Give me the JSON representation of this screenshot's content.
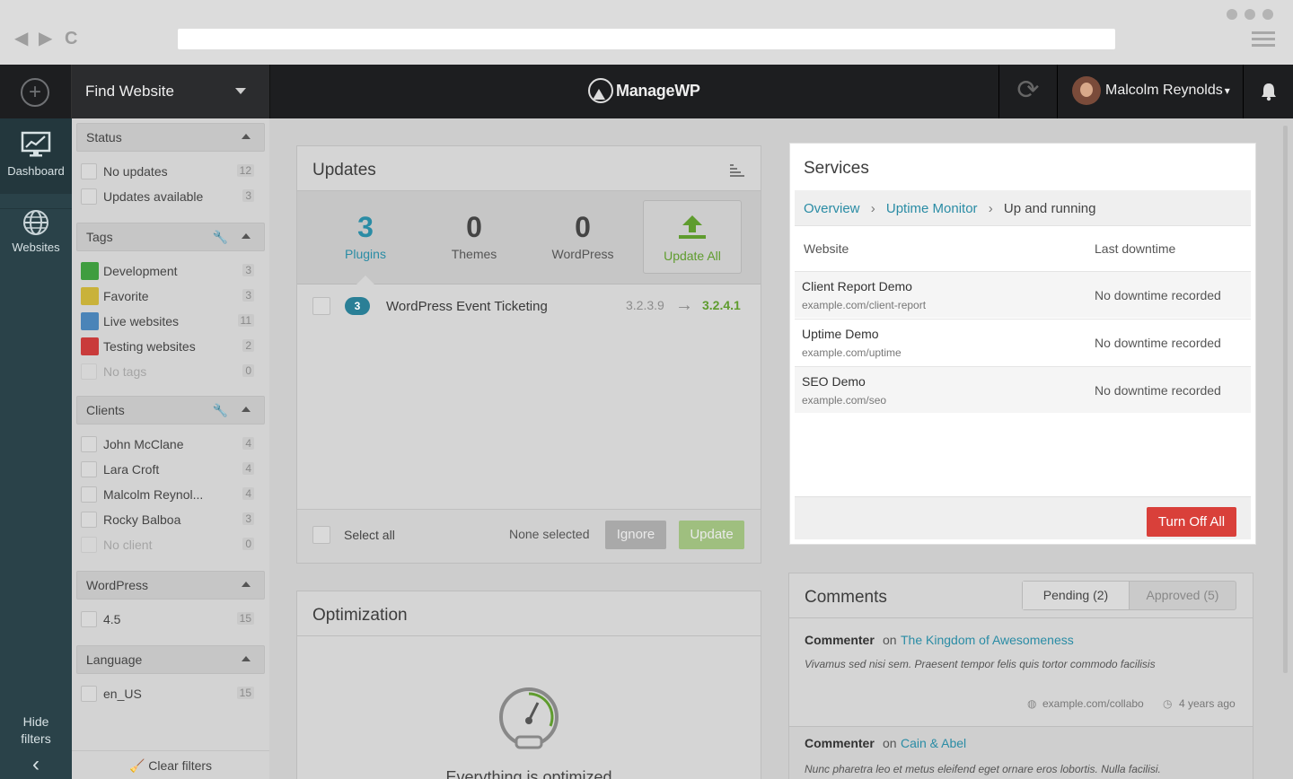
{
  "browser": {
    "nav_back": "◀",
    "nav_forward": "▶",
    "nav_reload": "C"
  },
  "topbar": {
    "add_icon": "+",
    "find_label": "Find Website",
    "logo_text": "ManageWP",
    "refresh_icon": "⟳",
    "user_name": "Malcolm Reynolds",
    "user_caret": "▾"
  },
  "sidebar": {
    "items": [
      {
        "label": "Dashboard",
        "icon": "chart-monitor-icon"
      },
      {
        "label": "Websites",
        "icon": "globe-icon"
      }
    ],
    "hide_filters": "Hide filters",
    "collapse": "‹"
  },
  "filters": {
    "status": {
      "title": "Status",
      "items": [
        {
          "label": "No updates",
          "count": "12"
        },
        {
          "label": "Updates available",
          "count": "3"
        }
      ]
    },
    "tags": {
      "title": "Tags",
      "items": [
        {
          "label": "Development",
          "count": "3",
          "color": "#3f9d3f"
        },
        {
          "label": "Favorite",
          "count": "3",
          "color": "#c9b23a"
        },
        {
          "label": "Live websites",
          "count": "11",
          "color": "#4a84b8"
        },
        {
          "label": "Testing websites",
          "count": "2",
          "color": "#c93b3b"
        },
        {
          "label": "No tags",
          "count": "0"
        }
      ]
    },
    "clients": {
      "title": "Clients",
      "items": [
        {
          "label": "John McClane",
          "count": "4"
        },
        {
          "label": "Lara Croft",
          "count": "4"
        },
        {
          "label": "Malcolm Reynol...",
          "count": "4"
        },
        {
          "label": "Rocky Balboa",
          "count": "3"
        },
        {
          "label": "No client",
          "count": "0"
        }
      ]
    },
    "wordpress": {
      "title": "WordPress",
      "items": [
        {
          "label": "4.5",
          "count": "15"
        }
      ]
    },
    "language": {
      "title": "Language",
      "items": [
        {
          "label": "en_US",
          "count": "15"
        }
      ]
    },
    "clear": "Clear filters"
  },
  "updates": {
    "title": "Updates",
    "stats": [
      {
        "value": "3",
        "label": "Plugins"
      },
      {
        "value": "0",
        "label": "Themes"
      },
      {
        "value": "0",
        "label": "WordPress"
      }
    ],
    "update_all": "Update All",
    "rows": [
      {
        "badge": "3",
        "name": "WordPress Event Ticketing",
        "from": "3.2.3.9",
        "arrow": "→",
        "to": "3.2.4.1"
      }
    ],
    "select_all": "Select all",
    "none_selected": "None selected",
    "ignore": "Ignore",
    "update": "Update"
  },
  "services": {
    "title": "Services",
    "breadcrumb": [
      "Overview",
      "Uptime Monitor",
      "Up and running"
    ],
    "breadcrumb_sep": "›",
    "col_website": "Website",
    "col_last": "Last downtime",
    "rows": [
      {
        "name": "Client Report Demo",
        "url": "example.com/client-report",
        "status": "No downtime recorded"
      },
      {
        "name": "Uptime Demo",
        "url": "example.com/uptime",
        "status": "No downtime recorded"
      },
      {
        "name": "SEO Demo",
        "url": "example.com/seo",
        "status": "No downtime recorded"
      }
    ],
    "turn_off_all": "Turn Off All"
  },
  "optimization": {
    "title": "Optimization",
    "message": "Everything is optimized"
  },
  "comments": {
    "title": "Comments",
    "tab_pending": "Pending (2)",
    "tab_approved": "Approved (5)",
    "items": [
      {
        "author": "Commenter",
        "on": "on",
        "post": "The Kingdom of Awesomeness",
        "text": "Vivamus sed nisi sem. Praesent tempor felis quis tortor commodo facilisis",
        "site": "example.com/collabo",
        "time": "4 years ago"
      },
      {
        "author": "Commenter",
        "on": "on",
        "post": "Cain & Abel",
        "text": "Nunc pharetra leo et metus eleifend eget ornare eros lobortis. Nulla facilisi."
      }
    ]
  }
}
